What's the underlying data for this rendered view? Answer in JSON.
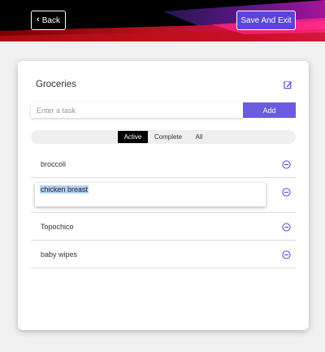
{
  "header": {
    "back_label": "Back",
    "save_label": "Save And Exit"
  },
  "list": {
    "title": "Groceries",
    "input_placeholder": "Enter a task",
    "add_label": "Add"
  },
  "filters": {
    "active": "Active",
    "complete": "Complete",
    "all": "All",
    "selected": "Active"
  },
  "tasks": [
    {
      "label": "broccoli"
    },
    {
      "label": "chicken breast",
      "editing": true
    },
    {
      "label": "Topochico"
    },
    {
      "label": "baby wipes"
    }
  ],
  "icons": {
    "back": "chevron-left-icon",
    "edit": "edit-icon",
    "remove": "minus-circle-icon"
  },
  "colors": {
    "accent": "#6b5be2",
    "save_button": "#5a44d9",
    "selection": "#b4d2f4"
  }
}
